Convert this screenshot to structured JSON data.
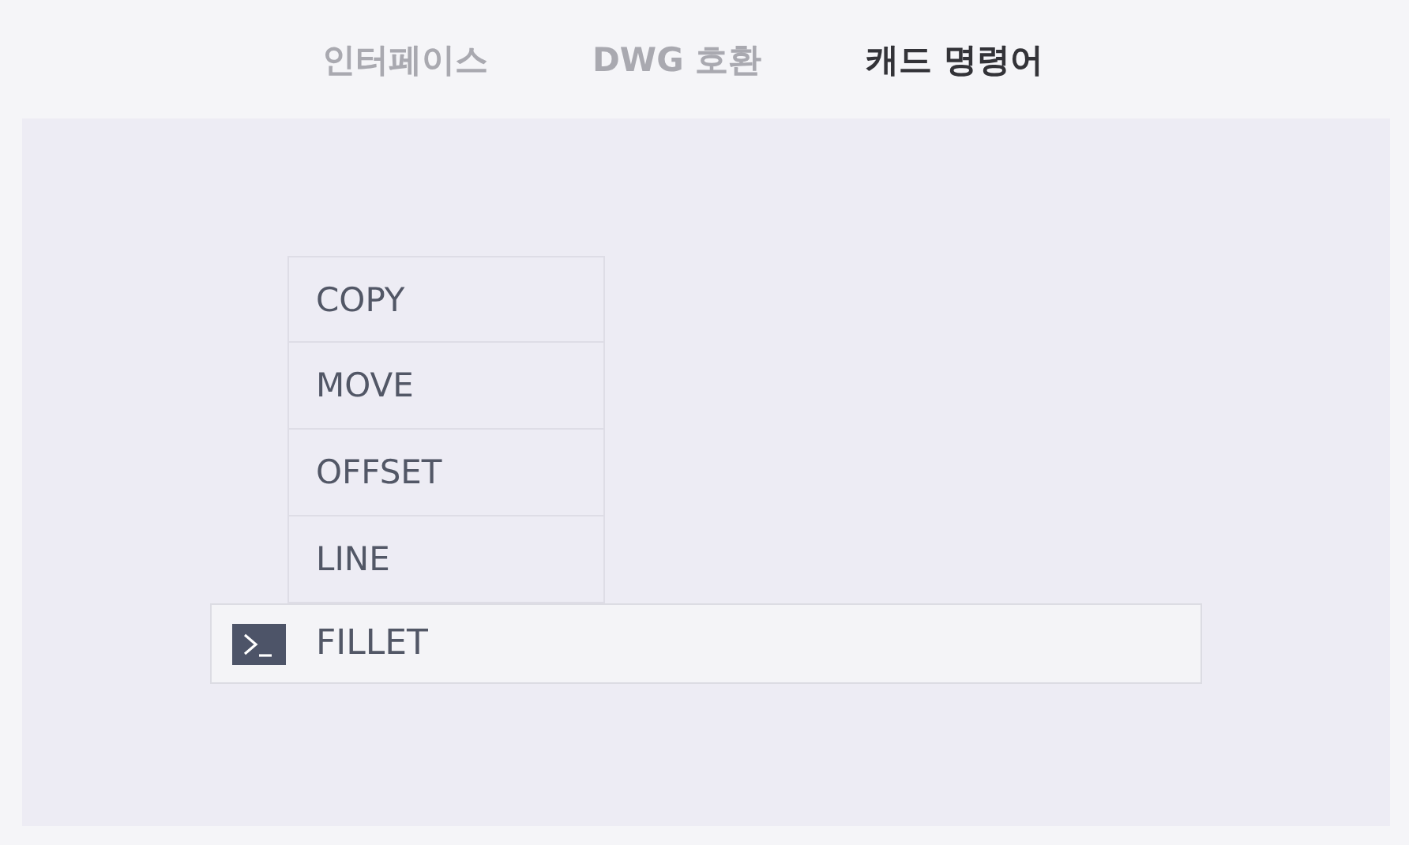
{
  "tabs": [
    {
      "label": "인터페이스",
      "selected": false
    },
    {
      "label": "DWG 호환",
      "selected": false
    },
    {
      "label": "캐드 명령어",
      "selected": true
    }
  ],
  "command_list": [
    "COPY",
    "MOVE",
    "OFFSET",
    "LINE"
  ],
  "command_line": {
    "value": "FILLET"
  }
}
